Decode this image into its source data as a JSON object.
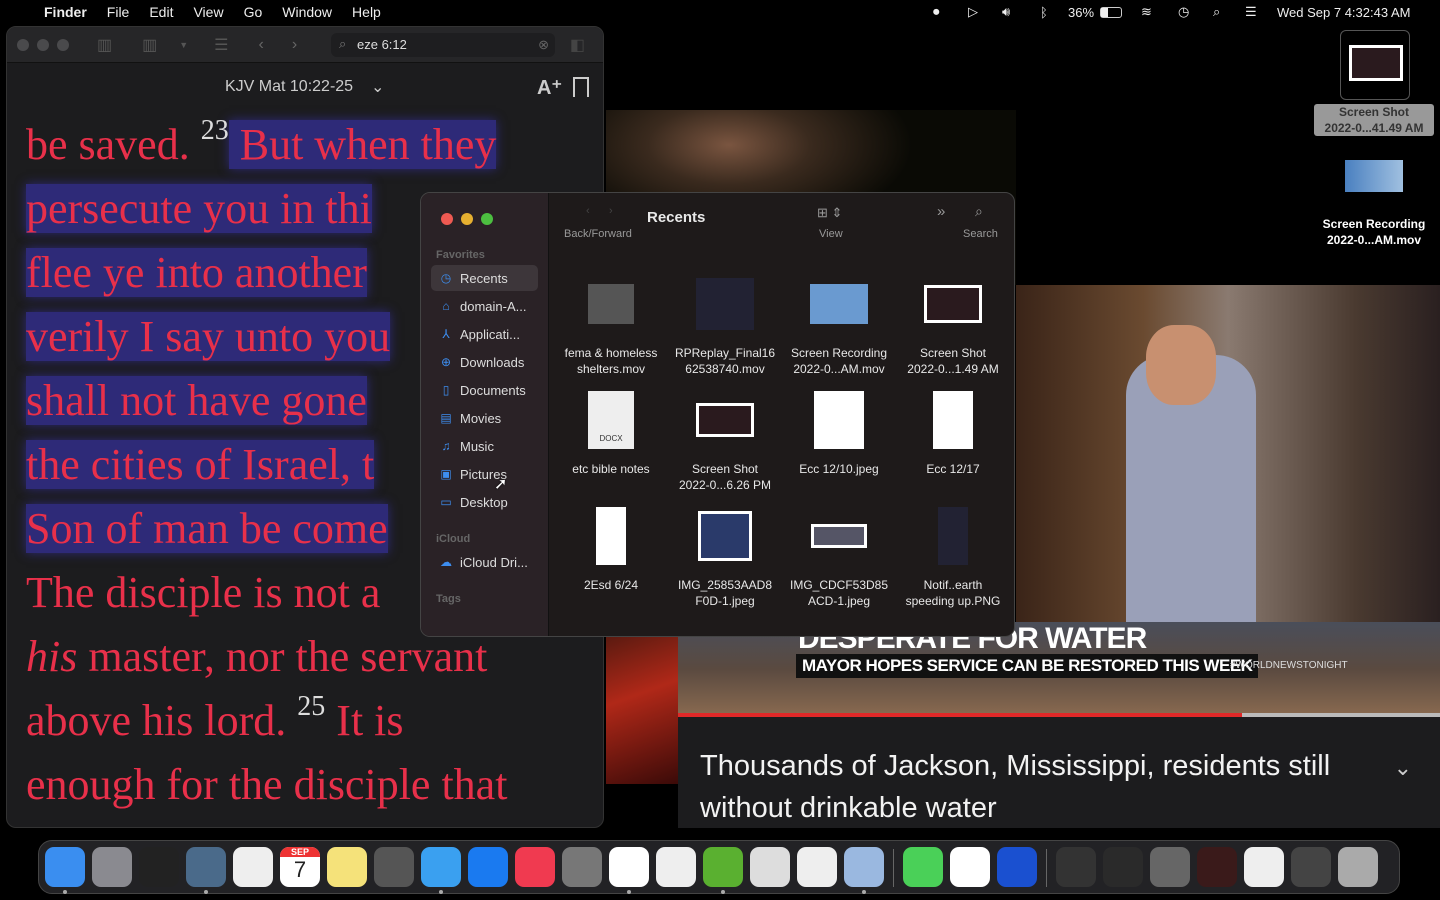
{
  "menubar": {
    "app": "Finder",
    "items": [
      "File",
      "Edit",
      "View",
      "Go",
      "Window",
      "Help"
    ],
    "battery": "36%",
    "datetime": "Wed Sep 7  4:32:43 AM"
  },
  "bible": {
    "search": "eze 6:12",
    "reference": "KJV Mat 10:22-25",
    "lines": [
      {
        "pre": "be saved. ",
        "verse": "23",
        "hl": " But when they"
      },
      {
        "hl": "persecute you in thi"
      },
      {
        "hl": "flee ye into another"
      },
      {
        "hl": "verily I say unto you"
      },
      {
        "hl": "shall not have gone"
      },
      {
        "hl": "the cities of Israel, t"
      },
      {
        "hl": "Son of man be come"
      },
      {
        "pre": "The disciple is not a"
      },
      {
        "it": "his",
        "pre": " master, nor the servant"
      },
      {
        "pre": "above his lord. ",
        "verse": "25",
        "post": " It is"
      },
      {
        "pre": "enough for the disciple that"
      }
    ]
  },
  "finder": {
    "title": "Recents",
    "toolbar": {
      "back_forward": "Back/Forward",
      "view": "View",
      "search": "Search"
    },
    "sidebar": {
      "favorites": "Favorites",
      "icloud": "iCloud",
      "tags": "Tags",
      "items": [
        {
          "label": "Recents",
          "icon": "clock"
        },
        {
          "label": "domain-A...",
          "icon": "drive"
        },
        {
          "label": "Applicati...",
          "icon": "apps"
        },
        {
          "label": "Downloads",
          "icon": "download"
        },
        {
          "label": "Documents",
          "icon": "doc"
        },
        {
          "label": "Movies",
          "icon": "film"
        },
        {
          "label": "Music",
          "icon": "note"
        },
        {
          "label": "Pictures",
          "icon": "photo"
        },
        {
          "label": "Desktop",
          "icon": "desktop"
        }
      ],
      "icloud_items": [
        {
          "label": "iCloud Dri...",
          "icon": "cloud"
        }
      ]
    },
    "files": [
      {
        "l1": "fema & homeless",
        "l2": "shelters.mov"
      },
      {
        "l1": "RPReplay_Final16",
        "l2": "62538740.mov"
      },
      {
        "l1": "Screen Recording",
        "l2": "2022-0...AM.mov"
      },
      {
        "l1": "Screen Shot",
        "l2": "2022-0...1.49 AM"
      },
      {
        "l1": "etc bible notes",
        "l2": "",
        "badge": "DOCX"
      },
      {
        "l1": "Screen Shot",
        "l2": "2022-0...6.26 PM"
      },
      {
        "l1": "Ecc 12/10.jpeg",
        "l2": ""
      },
      {
        "l1": "Ecc 12/17",
        "l2": ""
      },
      {
        "l1": "2Esd 6/24",
        "l2": ""
      },
      {
        "l1": "IMG_25853AAD8",
        "l2": "F0D-1.jpeg"
      },
      {
        "l1": "IMG_CDCF53D85",
        "l2": "ACD-1.jpeg"
      },
      {
        "l1": "Notif..earth",
        "l2": "speeding up.PNG"
      }
    ]
  },
  "desktop": [
    {
      "l1": "Screen Shot",
      "l2": "2022-0...41.49 AM"
    },
    {
      "l1": "Screen Recording",
      "l2": "2022-0...AM.mov"
    }
  ],
  "video": {
    "chyron": "DESPERATE FOR WATER",
    "subchyron": "MAYOR HOPES SERVICE CAN BE RESTORED THIS WEEK",
    "hashtag": "#WORLDNEWSTONIGHT",
    "progress": 0.74,
    "caption": "Thousands of Jackson, Mississippi, residents still without drinkable water"
  },
  "dock": {
    "calendar_month": "SEP",
    "calendar_day": "7",
    "apps": [
      {
        "name": "finder",
        "color": "#3a8ef0"
      },
      {
        "name": "launchpad",
        "color": "#8a8a90"
      },
      {
        "name": "migration",
        "color": "#222"
      },
      {
        "name": "quicktime",
        "color": "#4a6a8a"
      },
      {
        "name": "screenshot",
        "color": "#eee"
      },
      {
        "name": "calendar",
        "color": "#fff"
      },
      {
        "name": "notes",
        "color": "#f5e27a"
      },
      {
        "name": "photo-booth",
        "color": "#555"
      },
      {
        "name": "safari",
        "color": "#3aa0f0"
      },
      {
        "name": "app-store",
        "color": "#1a7af0"
      },
      {
        "name": "music",
        "color": "#f03a50"
      },
      {
        "name": "system-preferences",
        "color": "#777"
      },
      {
        "name": "word",
        "color": "#fff"
      },
      {
        "name": "imovie",
        "color": "#eee"
      },
      {
        "name": "ibooks",
        "color": "#5ab030"
      },
      {
        "name": "disk-utility",
        "color": "#ddd"
      },
      {
        "name": "system-information",
        "color": "#eee"
      },
      {
        "name": "preview",
        "color": "#9ab8e0"
      },
      {
        "name": "messages",
        "color": "#4ad058"
      },
      {
        "name": "excel",
        "color": "#fff"
      },
      {
        "name": "remote-desktop",
        "color": "#1a50d0"
      },
      {
        "name": "recent-doc-1",
        "color": "#333"
      },
      {
        "name": "recent-doc-2",
        "color": "#2a2a2a"
      },
      {
        "name": "recent-doc-3",
        "color": "#666"
      },
      {
        "name": "recent-doc-4",
        "color": "#3a1a1a"
      },
      {
        "name": "recent-doc-5",
        "color": "#eee"
      },
      {
        "name": "recent-doc-6",
        "color": "#444"
      },
      {
        "name": "trash",
        "color": "#aaa"
      }
    ]
  }
}
